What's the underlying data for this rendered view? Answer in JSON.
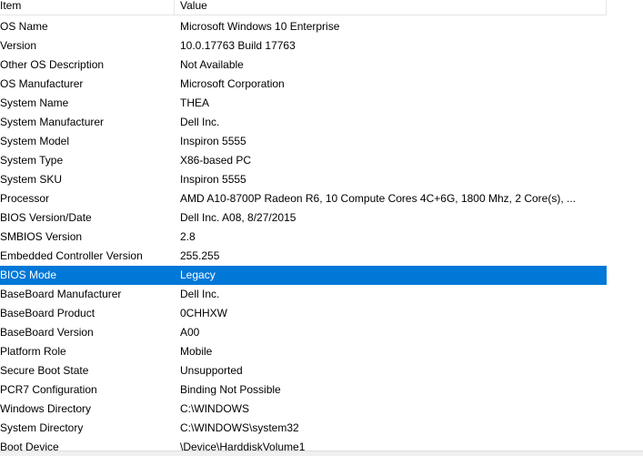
{
  "header": {
    "item": "Item",
    "value": "Value"
  },
  "rows": [
    {
      "item": "OS Name",
      "value": "Microsoft Windows 10 Enterprise"
    },
    {
      "item": "Version",
      "value": "10.0.17763 Build 17763"
    },
    {
      "item": "Other OS Description",
      "value": "Not Available"
    },
    {
      "item": "OS Manufacturer",
      "value": "Microsoft Corporation"
    },
    {
      "item": "System Name",
      "value": "THEA"
    },
    {
      "item": "System Manufacturer",
      "value": "Dell Inc."
    },
    {
      "item": "System Model",
      "value": "Inspiron 5555"
    },
    {
      "item": "System Type",
      "value": "X86-based PC"
    },
    {
      "item": "System SKU",
      "value": "Inspiron 5555"
    },
    {
      "item": "Processor",
      "value": "AMD A10-8700P Radeon R6, 10 Compute Cores 4C+6G, 1800 Mhz, 2 Core(s), ..."
    },
    {
      "item": "BIOS Version/Date",
      "value": "Dell Inc. A08, 8/27/2015"
    },
    {
      "item": "SMBIOS Version",
      "value": "2.8"
    },
    {
      "item": "Embedded Controller Version",
      "value": "255.255"
    },
    {
      "item": "BIOS Mode",
      "value": "Legacy"
    },
    {
      "item": "BaseBoard Manufacturer",
      "value": "Dell Inc."
    },
    {
      "item": "BaseBoard Product",
      "value": "0CHHXW"
    },
    {
      "item": "BaseBoard Version",
      "value": "A00"
    },
    {
      "item": "Platform Role",
      "value": "Mobile"
    },
    {
      "item": "Secure Boot State",
      "value": "Unsupported"
    },
    {
      "item": "PCR7 Configuration",
      "value": "Binding Not Possible"
    },
    {
      "item": "Windows Directory",
      "value": "C:\\WINDOWS"
    },
    {
      "item": "System Directory",
      "value": "C:\\WINDOWS\\system32"
    },
    {
      "item": "Boot Device",
      "value": "\\Device\\HarddiskVolume1"
    }
  ],
  "colors": {
    "selection": "#0078d7",
    "selection_text": "#ffffff",
    "header_border": "#e5e5e5"
  }
}
